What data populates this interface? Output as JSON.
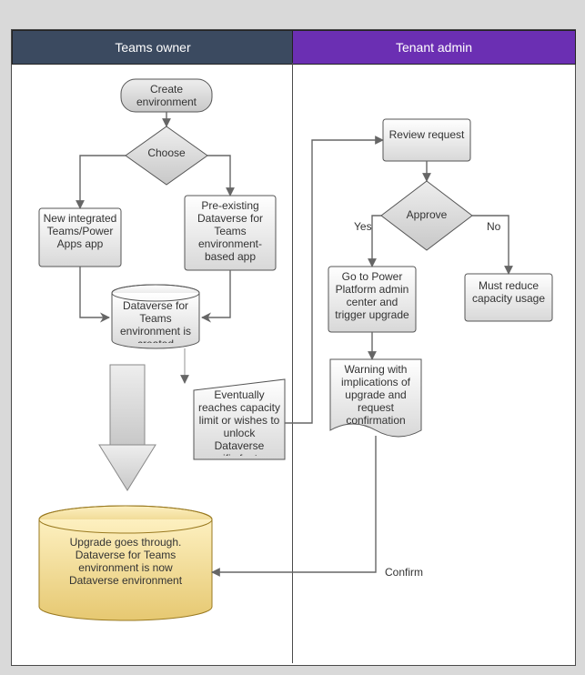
{
  "lanes": {
    "left": "Teams owner",
    "right": "Tenant admin"
  },
  "nodes": {
    "create": "Create environment",
    "choose": "Choose",
    "newApp": "New integrated Teams/Power Apps app",
    "preExisting": "Pre-existing Dataverse for Teams environment-based app",
    "dataverseCreated": "Dataverse for Teams environment is created",
    "eventually": "Eventually reaches capacity limit or wishes to unlock Dataverse specific features",
    "upgradeDone": "Upgrade goes through. Dataverse for Teams environment is now Dataverse environment",
    "review": "Review request",
    "approve": "Approve",
    "yes": "Yes",
    "no": "No",
    "goToAdmin": "Go to Power Platform admin center and trigger upgrade",
    "mustReduce": "Must reduce capacity usage",
    "warning": "Warning with implications of upgrade and request confirmation",
    "confirm": "Confirm"
  },
  "chart_data": {
    "type": "flowchart",
    "swimlanes": [
      "Teams owner",
      "Tenant admin"
    ],
    "nodes": [
      {
        "id": "create",
        "lane": "Teams owner",
        "type": "terminator",
        "label": "Create environment"
      },
      {
        "id": "choose",
        "lane": "Teams owner",
        "type": "decision",
        "label": "Choose"
      },
      {
        "id": "newApp",
        "lane": "Teams owner",
        "type": "process",
        "label": "New integrated Teams/Power Apps app"
      },
      {
        "id": "preExisting",
        "lane": "Teams owner",
        "type": "process",
        "label": "Pre-existing Dataverse for Teams environment-based app"
      },
      {
        "id": "dataverseCreated",
        "lane": "Teams owner",
        "type": "datastore",
        "label": "Dataverse for Teams environment is created"
      },
      {
        "id": "eventually",
        "lane": "Teams owner",
        "type": "input",
        "label": "Eventually reaches capacity limit or wishes to unlock Dataverse specific features"
      },
      {
        "id": "upgradeDone",
        "lane": "Teams owner",
        "type": "datastore",
        "label": "Upgrade goes through. Dataverse for Teams environment is now Dataverse environment"
      },
      {
        "id": "review",
        "lane": "Tenant admin",
        "type": "process",
        "label": "Review request"
      },
      {
        "id": "approve",
        "lane": "Tenant admin",
        "type": "decision",
        "label": "Approve"
      },
      {
        "id": "goToAdmin",
        "lane": "Tenant admin",
        "type": "process",
        "label": "Go to Power Platform admin center and trigger upgrade"
      },
      {
        "id": "mustReduce",
        "lane": "Tenant admin",
        "type": "process",
        "label": "Must reduce capacity usage"
      },
      {
        "id": "warning",
        "lane": "Tenant admin",
        "type": "document",
        "label": "Warning with implications of upgrade and request confirmation"
      },
      {
        "id": "upgradeDone2",
        "lane": "Teams owner",
        "type": "ref",
        "ref": "upgradeDone"
      }
    ],
    "edges": [
      {
        "from": "create",
        "to": "choose"
      },
      {
        "from": "choose",
        "to": "newApp"
      },
      {
        "from": "choose",
        "to": "preExisting"
      },
      {
        "from": "newApp",
        "to": "dataverseCreated"
      },
      {
        "from": "preExisting",
        "to": "dataverseCreated"
      },
      {
        "from": "dataverseCreated",
        "to": "eventually"
      },
      {
        "from": "eventually",
        "to": "review"
      },
      {
        "from": "review",
        "to": "approve"
      },
      {
        "from": "approve",
        "to": "goToAdmin",
        "label": "Yes"
      },
      {
        "from": "approve",
        "to": "mustReduce",
        "label": "No"
      },
      {
        "from": "goToAdmin",
        "to": "warning"
      },
      {
        "from": "warning",
        "to": "upgradeDone",
        "label": "Confirm"
      }
    ]
  }
}
